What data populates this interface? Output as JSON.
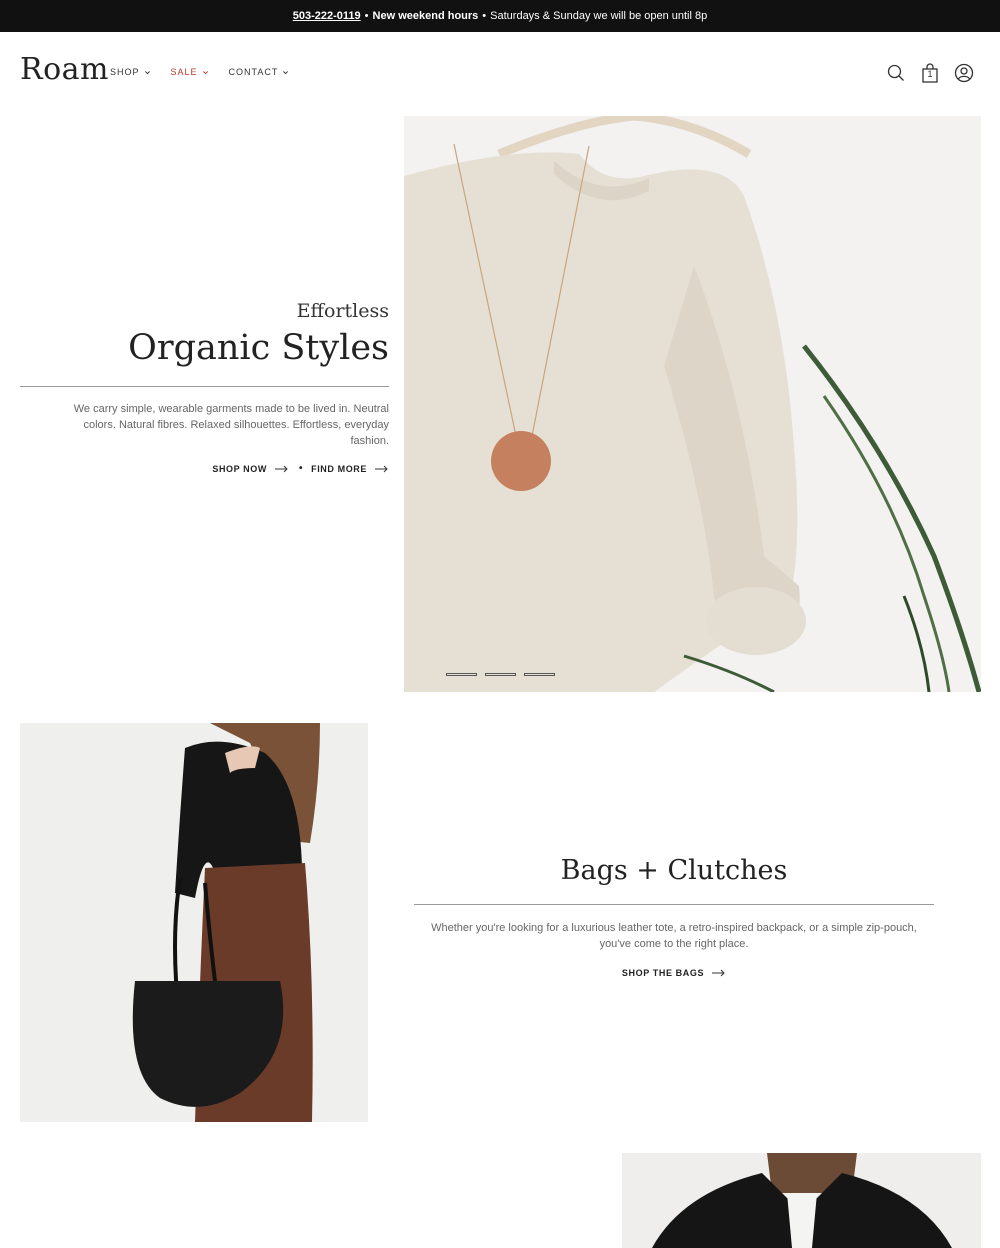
{
  "announcement": {
    "phone": "503-222-0119",
    "sep1": "•",
    "highlight": "New weekend hours",
    "sep2": "•",
    "message": "Saturdays & Sunday we will be open until 8p"
  },
  "header": {
    "logo": "Roam",
    "nav": [
      {
        "label": "SHOP"
      },
      {
        "label": "SALE"
      },
      {
        "label": "CONTACT"
      }
    ],
    "cart_count": "1"
  },
  "hero": {
    "kicker": "Effortless",
    "title": "Organic Styles",
    "description": "We carry simple, wearable garments made to be lived in. Neutral colors. Natural fibres. Relaxed silhouettes. Effortless, everyday fashion.",
    "link1": "SHOP NOW",
    "separator": "•",
    "link2": "FIND MORE"
  },
  "bags": {
    "title": "Bags + Clutches",
    "description": "Whether you're looking for a luxurious leather tote, a retro-inspired backpack, or a simple zip-pouch, you've come to the right place.",
    "link": "SHOP THE BAGS"
  },
  "colors": {
    "announce_bg": "#111111",
    "sale": "#b43a2b",
    "text": "#222222"
  }
}
